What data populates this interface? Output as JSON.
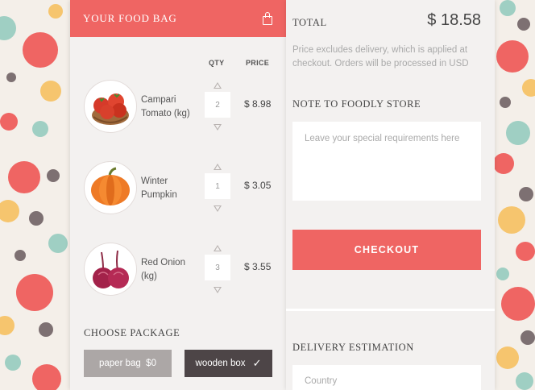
{
  "colors": {
    "accent": "#ef6563",
    "dark_button": "#4d4547",
    "grey_button": "#aca7a6",
    "panel_bg": "#f3f1f0"
  },
  "bag": {
    "title": "YOUR FOOD BAG",
    "icon": "shopping-bag-icon",
    "qty_header": "QTY",
    "price_header": "PRICE",
    "items": [
      {
        "name": "Campari Tomato (kg)",
        "qty": "2",
        "price": "$ 8.98",
        "icon": "tomato-image"
      },
      {
        "name": "Winter Pumpkin",
        "qty": "1",
        "price": "$ 3.05",
        "icon": "pumpkin-image"
      },
      {
        "name": "Red Onion (kg)",
        "qty": "3",
        "price": "$ 3.55",
        "icon": "onion-image"
      }
    ]
  },
  "package": {
    "title": "CHOOSE PACKAGE",
    "options": [
      {
        "label": "paper bag  $0",
        "selected": false
      },
      {
        "label": "wooden box",
        "selected": true
      }
    ],
    "check_icon": "✓"
  },
  "summary": {
    "total_label": "TOTAL",
    "total_value": "$ 18.58",
    "note_text": "Price excludes delivery, which is applied at checkout. Orders will be processed in USD"
  },
  "note": {
    "title": "NOTE TO FOODLY STORE",
    "placeholder": "Leave your special requirements here"
  },
  "checkout": {
    "label": "CHECKOUT"
  },
  "delivery": {
    "title": "DELIVERY ESTIMATION",
    "country_placeholder": "Country"
  }
}
